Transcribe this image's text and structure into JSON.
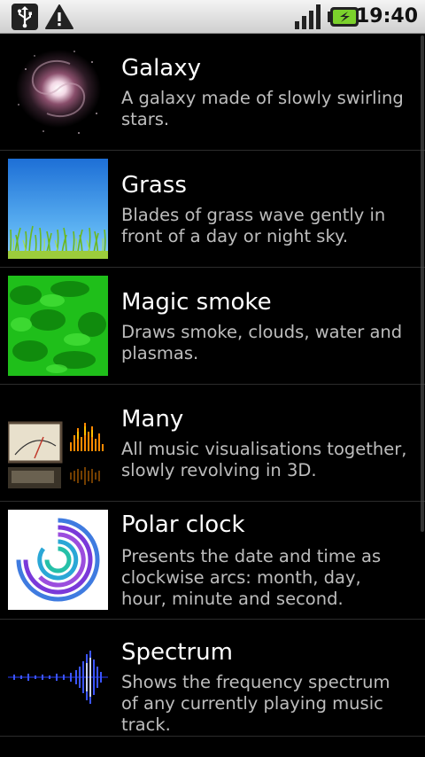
{
  "status_bar": {
    "time": "19:40",
    "icons": [
      "usb-icon",
      "warning-icon",
      "signal-icon",
      "battery-charging-icon"
    ]
  },
  "wallpapers": [
    {
      "title": "Galaxy",
      "description": "A galaxy made of slowly swirling stars.",
      "thumbnail": "galaxy-thumbnail"
    },
    {
      "title": "Grass",
      "description": "Blades of grass wave gently in front of a day or night sky.",
      "thumbnail": "grass-thumbnail"
    },
    {
      "title": "Magic smoke",
      "description": "Draws smoke, clouds, water and plasmas.",
      "thumbnail": "magic-smoke-thumbnail"
    },
    {
      "title": "Many",
      "description": "All music visualisations together, slowly revolving in 3D.",
      "thumbnail": "many-thumbnail"
    },
    {
      "title": "Polar clock",
      "description": "Presents the date and time as clockwise arcs: month, day, hour, minute and second.",
      "thumbnail": "polar-clock-thumbnail"
    },
    {
      "title": "Spectrum",
      "description": "Shows the frequency spectrum of any currently playing music track.",
      "thumbnail": "spectrum-thumbnail"
    }
  ]
}
